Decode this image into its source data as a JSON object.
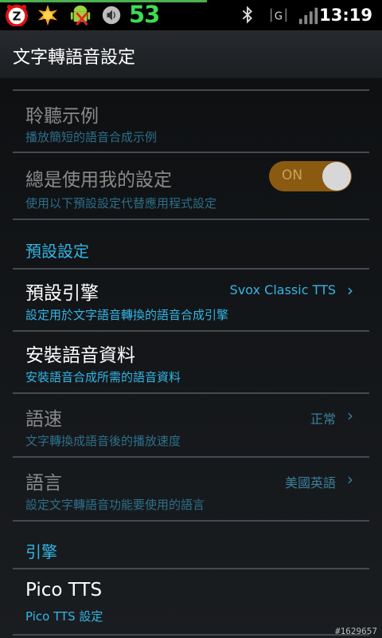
{
  "status_bar": {
    "battery_level": "53",
    "clock": "13:19",
    "left_icons": [
      "z-app-icon",
      "sun-icon",
      "android-icon",
      "volume-icon"
    ],
    "right_icons": [
      "bluetooth-icon",
      "network-g-icon",
      "signal-icon"
    ],
    "accent": "#3ddc54"
  },
  "action_bar": {
    "title": "文字轉語音設定"
  },
  "rows": {
    "listen_example": {
      "title": "聆聽示例",
      "summary": "播放簡短的語音合成示例"
    },
    "always_use": {
      "title": "總是使用我的設定",
      "summary": "使用以下預設設定代替應用程式設定",
      "toggle_label": "ON",
      "toggle_on": true
    },
    "default_header": "預設設定",
    "default_engine": {
      "title": "預設引擎",
      "summary": "設定用於文字語音轉換的語音合成引擎",
      "value": "Svox Classic TTS"
    },
    "install_voice": {
      "title": "安裝語音資料",
      "summary": "安裝語音合成所需的語音資料"
    },
    "speech_rate": {
      "title": "語速",
      "summary": "文字轉換成語音後的播放速度",
      "value": "正常"
    },
    "language": {
      "title": "語言",
      "summary": "設定文字轉語音功能要使用的語言",
      "value": "美國英語"
    },
    "engines_header": "引擎",
    "pico": {
      "title": "Pico TTS",
      "summary": "Pico TTS 設定"
    }
  },
  "watermark": "#1629657",
  "colors": {
    "accent_blue": "#33b5e5",
    "toggle_on": "#8a5a10"
  }
}
